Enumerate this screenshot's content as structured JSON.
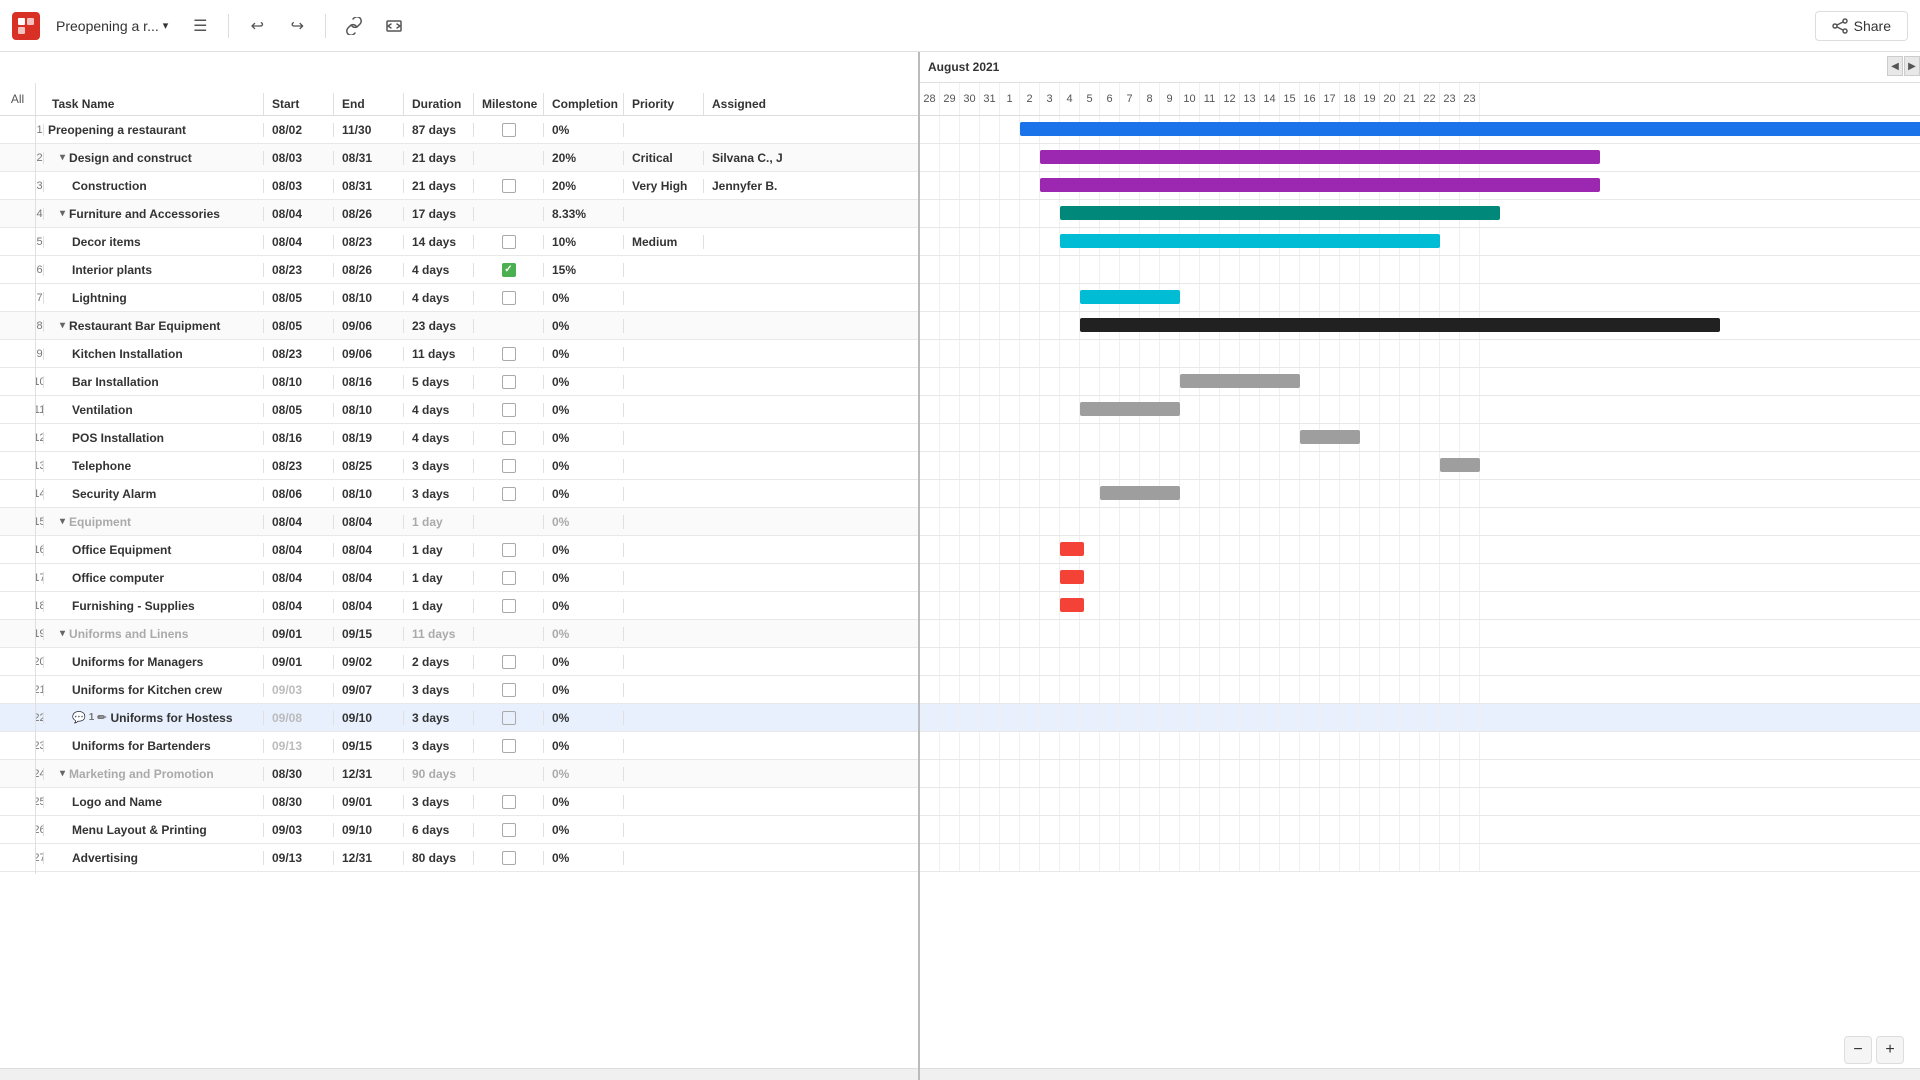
{
  "toolbar": {
    "logo": "P",
    "title": "Preopening a r...",
    "share_label": "Share",
    "undo_icon": "↩",
    "redo_icon": "↪"
  },
  "header": {
    "all_label": "All",
    "columns": [
      "Task Name",
      "Start",
      "End",
      "Duration",
      "Milestone",
      "Completion",
      "Priority",
      "Assigned"
    ]
  },
  "gantt_month": "August 2021",
  "gantt_days": [
    "28",
    "29",
    "30",
    "31",
    "1",
    "2",
    "3",
    "4",
    "5",
    "6",
    "7",
    "8",
    "9",
    "10",
    "11",
    "12",
    "13",
    "14",
    "15",
    "16",
    "17",
    "18",
    "19",
    "20",
    "21",
    "22",
    "23",
    "23"
  ],
  "rows": [
    {
      "num": "1",
      "name": "Preopening a restaurant",
      "start": "08/02",
      "end": "11/30",
      "duration": "87 days",
      "milestone": false,
      "completion": "0%",
      "priority": "",
      "assigned": "",
      "indent": 0,
      "group": false,
      "bold": true
    },
    {
      "num": "2",
      "name": "Design and construct",
      "start": "08/03",
      "end": "08/31",
      "duration": "21 days",
      "milestone": false,
      "completion": "20%",
      "priority": "Critical",
      "assigned": "Silvana C., J",
      "indent": 1,
      "group": true,
      "collapse": true
    },
    {
      "num": "3",
      "name": "Construction",
      "start": "08/03",
      "end": "08/31",
      "duration": "21 days",
      "milestone": false,
      "completion": "20%",
      "priority": "Very High",
      "assigned": "Jennyfer B.",
      "indent": 2,
      "group": false
    },
    {
      "num": "4",
      "name": "Furniture and Accessories",
      "start": "08/04",
      "end": "08/26",
      "duration": "17 days",
      "milestone": false,
      "completion": "8.33%",
      "priority": "",
      "assigned": "",
      "indent": 1,
      "group": true,
      "collapse": true
    },
    {
      "num": "5",
      "name": "Decor items",
      "start": "08/04",
      "end": "08/23",
      "duration": "14 days",
      "milestone": false,
      "completion": "10%",
      "priority": "Medium",
      "assigned": "",
      "indent": 2,
      "group": false
    },
    {
      "num": "6",
      "name": "Interior plants",
      "start": "08/23",
      "end": "08/26",
      "duration": "4 days",
      "milestone": true,
      "completion": "15%",
      "priority": "",
      "assigned": "",
      "indent": 2,
      "group": false
    },
    {
      "num": "7",
      "name": "Lightning",
      "start": "08/05",
      "end": "08/10",
      "duration": "4 days",
      "milestone": false,
      "completion": "0%",
      "priority": "",
      "assigned": "",
      "indent": 2,
      "group": false
    },
    {
      "num": "8",
      "name": "Restaurant Bar Equipment",
      "start": "08/05",
      "end": "09/06",
      "duration": "23 days",
      "milestone": false,
      "completion": "0%",
      "priority": "",
      "assigned": "",
      "indent": 1,
      "group": true,
      "collapse": true
    },
    {
      "num": "9",
      "name": "Kitchen Installation",
      "start": "08/23",
      "end": "09/06",
      "duration": "11 days",
      "milestone": false,
      "completion": "0%",
      "priority": "",
      "assigned": "",
      "indent": 2,
      "group": false
    },
    {
      "num": "10",
      "name": "Bar Installation",
      "start": "08/10",
      "end": "08/16",
      "duration": "5 days",
      "milestone": false,
      "completion": "0%",
      "priority": "",
      "assigned": "",
      "indent": 2,
      "group": false
    },
    {
      "num": "11",
      "name": "Ventilation",
      "start": "08/05",
      "end": "08/10",
      "duration": "4 days",
      "milestone": false,
      "completion": "0%",
      "priority": "",
      "assigned": "",
      "indent": 2,
      "group": false
    },
    {
      "num": "12",
      "name": "POS Installation",
      "start": "08/16",
      "end": "08/19",
      "duration": "4 days",
      "milestone": false,
      "completion": "0%",
      "priority": "",
      "assigned": "",
      "indent": 2,
      "group": false
    },
    {
      "num": "13",
      "name": "Telephone",
      "start": "08/23",
      "end": "08/25",
      "duration": "3 days",
      "milestone": false,
      "completion": "0%",
      "priority": "",
      "assigned": "",
      "indent": 2,
      "group": false
    },
    {
      "num": "14",
      "name": "Security Alarm",
      "start": "08/06",
      "end": "08/10",
      "duration": "3 days",
      "milestone": false,
      "completion": "0%",
      "priority": "",
      "assigned": "",
      "indent": 2,
      "group": false
    },
    {
      "num": "15",
      "name": "Equipment",
      "start": "08/04",
      "end": "08/04",
      "duration": "1 day",
      "milestone": false,
      "completion": "0%",
      "priority": "",
      "assigned": "",
      "indent": 1,
      "group": true,
      "collapse": true,
      "muted": true
    },
    {
      "num": "16",
      "name": "Office Equipment",
      "start": "08/04",
      "end": "08/04",
      "duration": "1 day",
      "milestone": false,
      "completion": "0%",
      "priority": "",
      "assigned": "",
      "indent": 2,
      "group": false
    },
    {
      "num": "17",
      "name": "Office computer",
      "start": "08/04",
      "end": "08/04",
      "duration": "1 day",
      "milestone": false,
      "completion": "0%",
      "priority": "",
      "assigned": "",
      "indent": 2,
      "group": false
    },
    {
      "num": "18",
      "name": "Furnishing - Supplies",
      "start": "08/04",
      "end": "08/04",
      "duration": "1 day",
      "milestone": false,
      "completion": "0%",
      "priority": "",
      "assigned": "",
      "indent": 2,
      "group": false
    },
    {
      "num": "19",
      "name": "Uniforms and Linens",
      "start": "09/01",
      "end": "09/15",
      "duration": "11 days",
      "milestone": false,
      "completion": "0%",
      "priority": "",
      "assigned": "",
      "indent": 1,
      "group": true,
      "collapse": true,
      "muted": true
    },
    {
      "num": "20",
      "name": "Uniforms for Managers",
      "start": "09/01",
      "end": "09/02",
      "duration": "2 days",
      "milestone": false,
      "completion": "0%",
      "priority": "",
      "assigned": "",
      "indent": 2,
      "group": false
    },
    {
      "num": "21",
      "name": "Uniforms for Kitchen crew",
      "start": "09/03",
      "end": "09/07",
      "duration": "3 days",
      "milestone": false,
      "completion": "0%",
      "priority": "",
      "assigned": "",
      "indent": 2,
      "group": false,
      "muted_start": true
    },
    {
      "num": "22",
      "name": "Uniforms for Hostess",
      "start": "09/08",
      "end": "09/10",
      "duration": "3 days",
      "milestone": false,
      "completion": "0%",
      "priority": "",
      "assigned": "",
      "indent": 2,
      "group": false,
      "selected": true,
      "has_icons": true,
      "muted_start": true
    },
    {
      "num": "23",
      "name": "Uniforms for Bartenders",
      "start": "09/13",
      "end": "09/15",
      "duration": "3 days",
      "milestone": false,
      "completion": "0%",
      "priority": "",
      "assigned": "",
      "indent": 2,
      "group": false,
      "muted_start": true
    },
    {
      "num": "24",
      "name": "Marketing and Promotion",
      "start": "08/30",
      "end": "12/31",
      "duration": "90 days",
      "milestone": false,
      "completion": "0%",
      "priority": "",
      "assigned": "",
      "indent": 1,
      "group": true,
      "collapse": true,
      "muted": true
    },
    {
      "num": "25",
      "name": "Logo and Name",
      "start": "08/30",
      "end": "09/01",
      "duration": "3 days",
      "milestone": false,
      "completion": "0%",
      "priority": "",
      "assigned": "",
      "indent": 2,
      "group": false
    },
    {
      "num": "26",
      "name": "Menu Layout & Printing",
      "start": "09/03",
      "end": "09/10",
      "duration": "6 days",
      "milestone": false,
      "completion": "0%",
      "priority": "",
      "assigned": "",
      "indent": 2,
      "group": false
    },
    {
      "num": "27",
      "name": "Advertising",
      "start": "09/13",
      "end": "12/31",
      "duration": "80 days",
      "milestone": false,
      "completion": "0%",
      "priority": "",
      "assigned": "",
      "indent": 2,
      "group": false
    }
  ],
  "colors": {
    "bar_blue_dark": "#1a73e8",
    "bar_purple": "#9c27b0",
    "bar_teal": "#00897b",
    "bar_teal2": "#00bcd4",
    "bar_gray": "#9e9e9e",
    "bar_red": "#f44336",
    "bar_black": "#212121"
  }
}
